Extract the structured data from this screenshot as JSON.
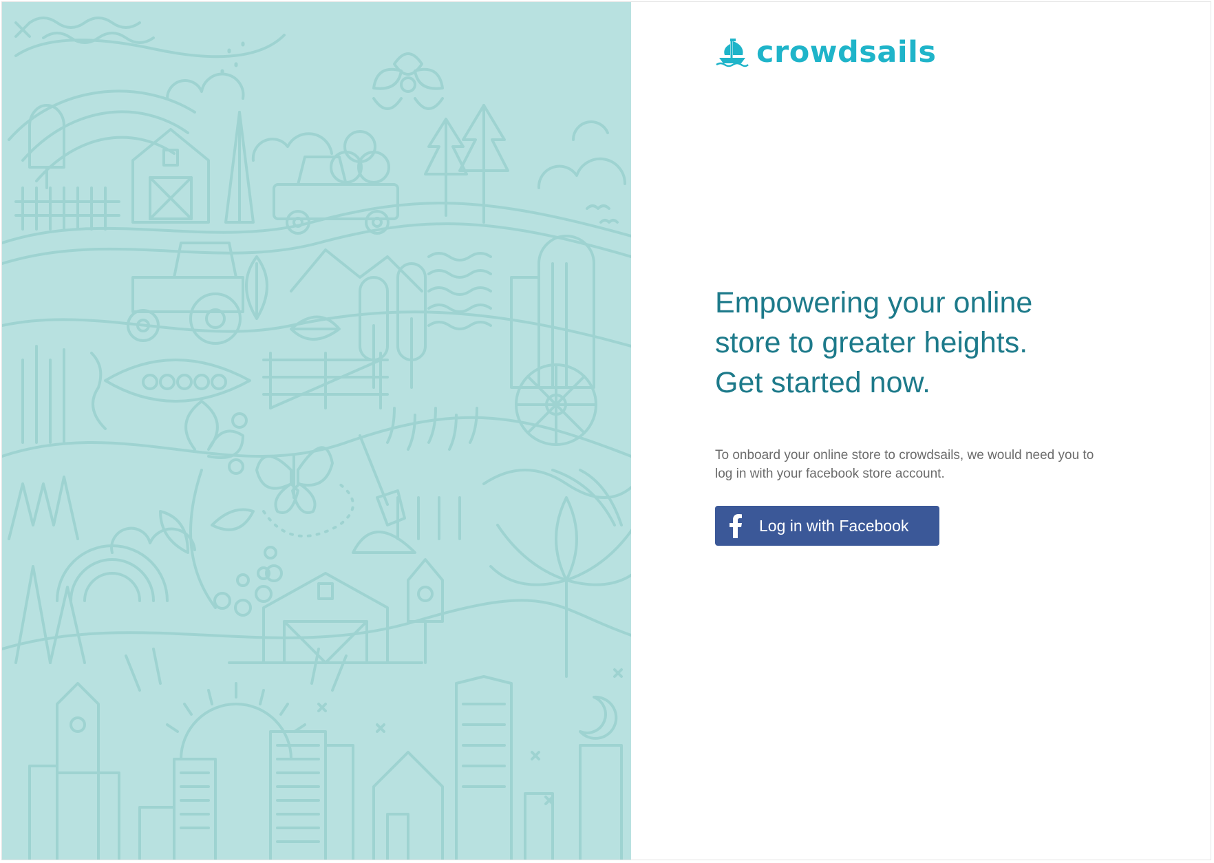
{
  "brand": {
    "name": "crowdsails",
    "logo_icon": "ship-icon",
    "color": "#1fb4c9"
  },
  "hero": {
    "line1": "Empowering your online",
    "line2": "store to greater heights.",
    "line3": "Get started now.",
    "color": "#1d7a8a"
  },
  "description": {
    "text": "To onboard your online store  to crowdsails, we would need you to log in with your facebook store account."
  },
  "login": {
    "label": "Log in with Facebook",
    "icon": "facebook-icon",
    "color": "#3b5898"
  },
  "illustration": {
    "icon": "farm-city-pattern-illustration",
    "background": "#b8e1e0",
    "line_color": "#9ed3d1"
  }
}
